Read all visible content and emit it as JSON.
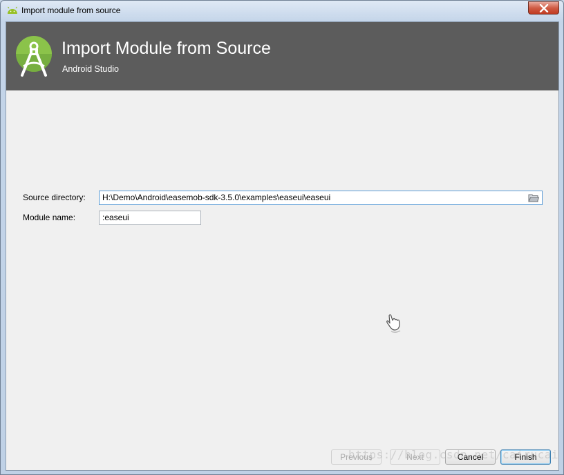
{
  "window": {
    "title": "Import module from source",
    "close_icon": "close-icon"
  },
  "header": {
    "title": "Import Module from Source",
    "subtitle": "Android Studio",
    "logo_icon": "android-studio-logo",
    "background": "#5c5c5c"
  },
  "form": {
    "source_label": "Source directory:",
    "source_value": "H:\\Demo\\Android\\easemob-sdk-3.5.0\\examples\\easeui\\easeui",
    "browse_icon": "folder-icon",
    "module_label": "Module name:",
    "module_value": ":easeui"
  },
  "buttons": {
    "previous": "Previous",
    "next": "Next",
    "cancel": "Cancel",
    "finish": "Finish"
  },
  "watermark": "https://blog.csdn.net/cairucai",
  "colors": {
    "accent": "#3c7fb1",
    "logo_green": "#8bc34a"
  }
}
